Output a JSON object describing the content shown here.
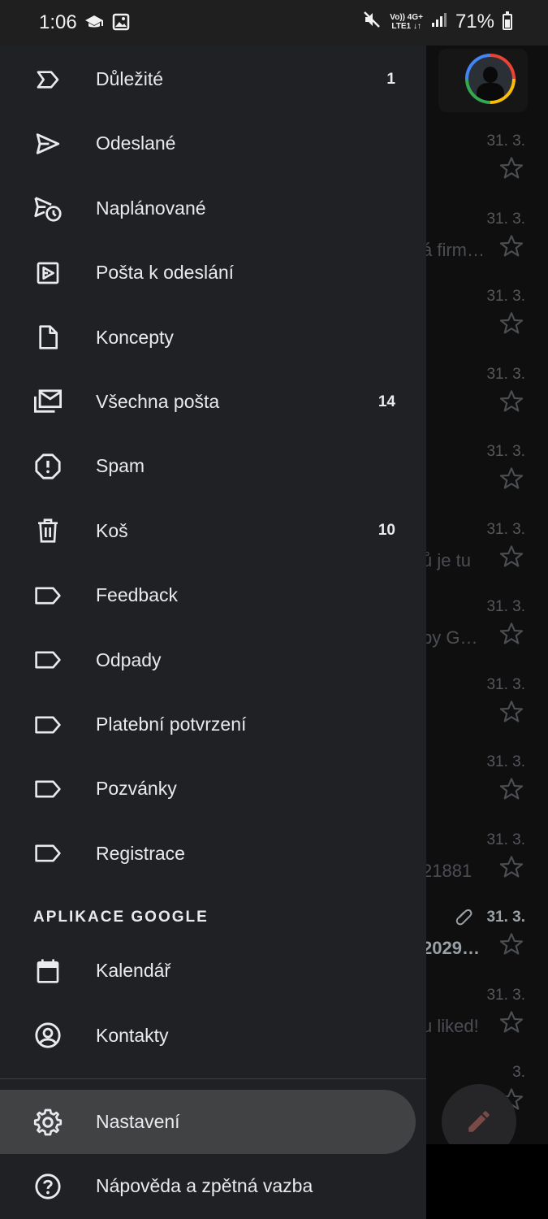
{
  "status_bar": {
    "time": "1:06",
    "network_top": "Vo)) 4G+",
    "network_bottom": "LTE1 ↓↑",
    "battery_text": "71%",
    "battery_level": 0.71
  },
  "inbox_background": {
    "rows": [
      {
        "date": "31. 3.",
        "snippet": "",
        "bold": false,
        "attachment": false
      },
      {
        "date": "31. 3.",
        "snippet": "á firm…",
        "bold": false,
        "attachment": false
      },
      {
        "date": "31. 3.",
        "snippet": "",
        "bold": false,
        "attachment": false
      },
      {
        "date": "31. 3.",
        "snippet": "",
        "bold": false,
        "attachment": false
      },
      {
        "date": "31. 3.",
        "snippet": "",
        "bold": false,
        "attachment": false
      },
      {
        "date": "31. 3.",
        "snippet": "ů je tu",
        "bold": false,
        "attachment": false
      },
      {
        "date": "31. 3.",
        "snippet": "by G…",
        "bold": false,
        "attachment": false
      },
      {
        "date": "31. 3.",
        "snippet": "",
        "bold": false,
        "attachment": false
      },
      {
        "date": "31. 3.",
        "snippet": "",
        "bold": false,
        "attachment": false
      },
      {
        "date": "31. 3.",
        "snippet": "21881",
        "bold": false,
        "attachment": false
      },
      {
        "date": "31. 3.",
        "snippet": "2029…",
        "bold": true,
        "attachment": true
      },
      {
        "date": "31. 3.",
        "snippet": "u liked!",
        "bold": false,
        "attachment": false
      },
      {
        "date": "3.",
        "snippet": "",
        "bold": false,
        "attachment": false
      }
    ]
  },
  "drawer": {
    "items": [
      {
        "name": "nav-item-important",
        "icon": "important-icon",
        "label": "Důležité",
        "count": "1"
      },
      {
        "name": "nav-item-sent",
        "icon": "send-icon",
        "label": "Odeslané",
        "count": ""
      },
      {
        "name": "nav-item-scheduled",
        "icon": "schedule-send-icon",
        "label": "Naplánované",
        "count": ""
      },
      {
        "name": "nav-item-outbox",
        "icon": "outbox-icon",
        "label": "Pošta k odeslání",
        "count": ""
      },
      {
        "name": "nav-item-drafts",
        "icon": "draft-icon",
        "label": "Koncepty",
        "count": ""
      },
      {
        "name": "nav-item-all-mail",
        "icon": "all-mail-icon",
        "label": "Všechna pošta",
        "count": "14"
      },
      {
        "name": "nav-item-spam",
        "icon": "spam-icon",
        "label": "Spam",
        "count": ""
      },
      {
        "name": "nav-item-trash",
        "icon": "trash-icon",
        "label": "Koš",
        "count": "10"
      },
      {
        "name": "nav-item-label-feedback",
        "icon": "label-icon",
        "label": "Feedback",
        "count": ""
      },
      {
        "name": "nav-item-label-odpady",
        "icon": "label-icon",
        "label": "Odpady",
        "count": ""
      },
      {
        "name": "nav-item-label-platebni-potvrzeni",
        "icon": "label-icon",
        "label": "Platební potvrzení",
        "count": ""
      },
      {
        "name": "nav-item-label-pozvanky",
        "icon": "label-icon",
        "label": "Pozvánky",
        "count": ""
      },
      {
        "name": "nav-item-label-registrace",
        "icon": "label-icon",
        "label": "Registrace",
        "count": ""
      }
    ],
    "google_apps_header": "APLIKACE GOOGLE",
    "google_apps": [
      {
        "name": "nav-item-calendar",
        "icon": "calendar-icon",
        "label": "Kalendář"
      },
      {
        "name": "nav-item-contacts",
        "icon": "contacts-icon",
        "label": "Kontakty"
      }
    ],
    "footer": [
      {
        "name": "nav-item-settings",
        "icon": "gear-icon",
        "label": "Nastavení",
        "selected": true
      },
      {
        "name": "nav-item-help",
        "icon": "help-icon",
        "label": "Nápověda a zpětná vazba",
        "selected": false
      }
    ]
  },
  "colors": {
    "drawer_bg": "#202124",
    "selected_bg": "#414244",
    "text": "#e8eaed",
    "compose_pencil": "#f28b82"
  }
}
